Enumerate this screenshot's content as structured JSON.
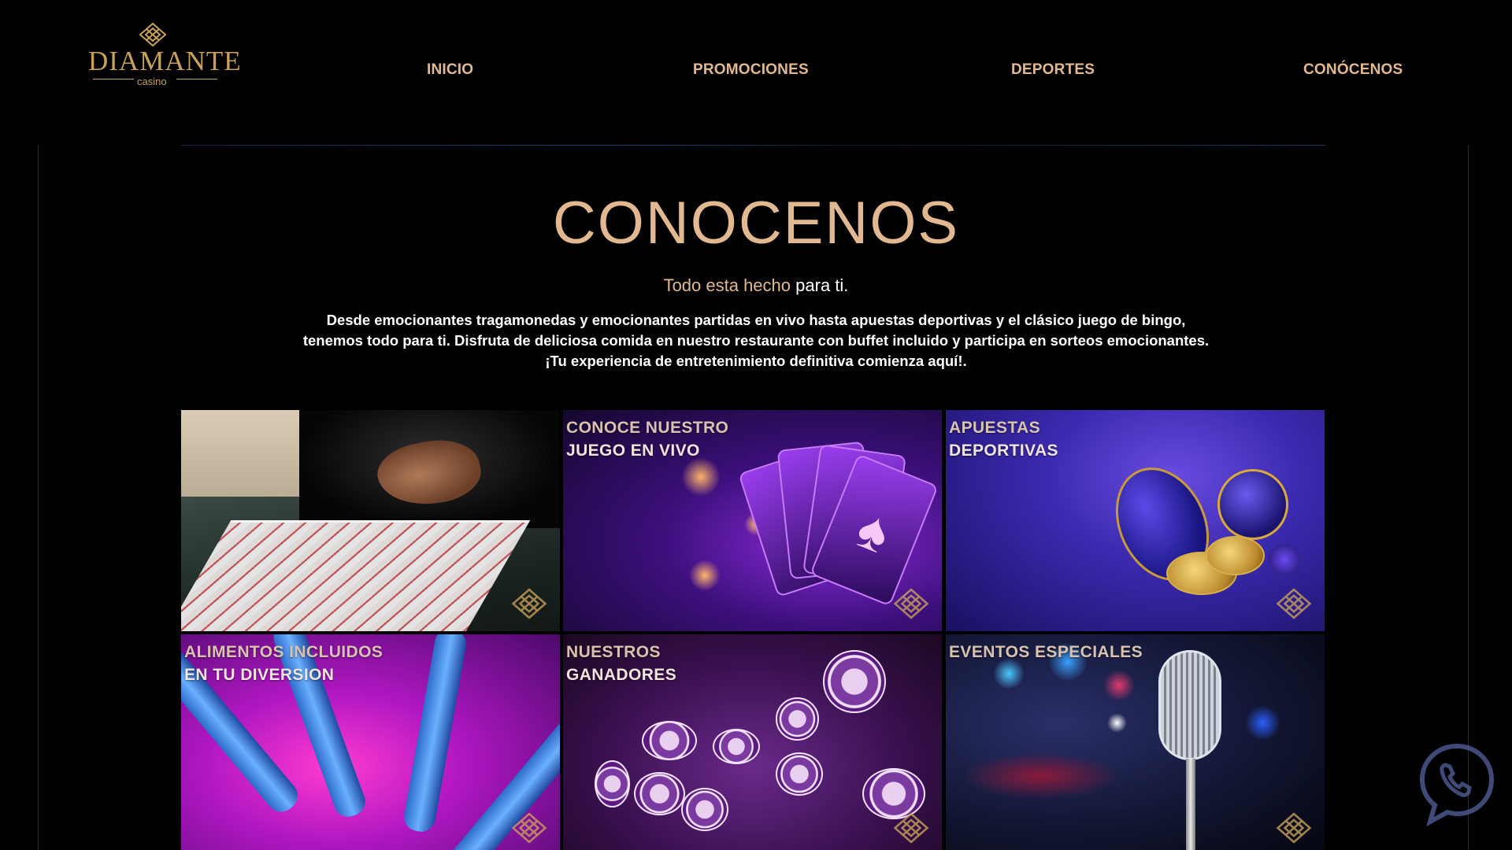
{
  "brand": {
    "name": "DIAMANTE",
    "sub": "casino",
    "accent": "#e2b891",
    "logo_color": "#c8a15a"
  },
  "nav": {
    "items": [
      {
        "label": "INICIO"
      },
      {
        "label": "PROMOCIONES"
      },
      {
        "label": "DEPORTES"
      },
      {
        "label": "CONÓCENOS"
      }
    ]
  },
  "about": {
    "title": "CONOCENOS",
    "subtitle_gold": "Todo esta hecho",
    "subtitle_white": "para ti.",
    "description": "Desde emocionantes tragamonedas y emocionantes partidas en vivo hasta apuestas deportivas y el clásico juego de bingo, tenemos todo para ti. Disfruta de deliciosa comida en nuestro restaurante con buffet incluido y participa en sorteos emocionantes. ¡Tu experiencia de entretenimiento definitiva comienza aquí!."
  },
  "tiles": [
    {
      "line1": "",
      "line2": "",
      "icon": "diamond-logo-icon"
    },
    {
      "line1": "CONOCE NUESTRO",
      "line2": "JUEGO EN VIVO",
      "icon": "diamond-logo-icon"
    },
    {
      "line1": "APUESTAS",
      "line2": "DEPORTIVAS",
      "icon": "diamond-logo-icon"
    },
    {
      "line1": "ALIMENTOS INCLUIDOS",
      "line2": "EN TU DIVERSION",
      "icon": "diamond-logo-icon"
    },
    {
      "line1": "NUESTROS",
      "line2": "GANADORES",
      "icon": "diamond-logo-icon"
    },
    {
      "line1": "EVENTOS ESPECIALES",
      "line2": "",
      "icon": "diamond-logo-icon"
    }
  ],
  "widgets": {
    "phone_icon": "phone-chat-icon"
  }
}
